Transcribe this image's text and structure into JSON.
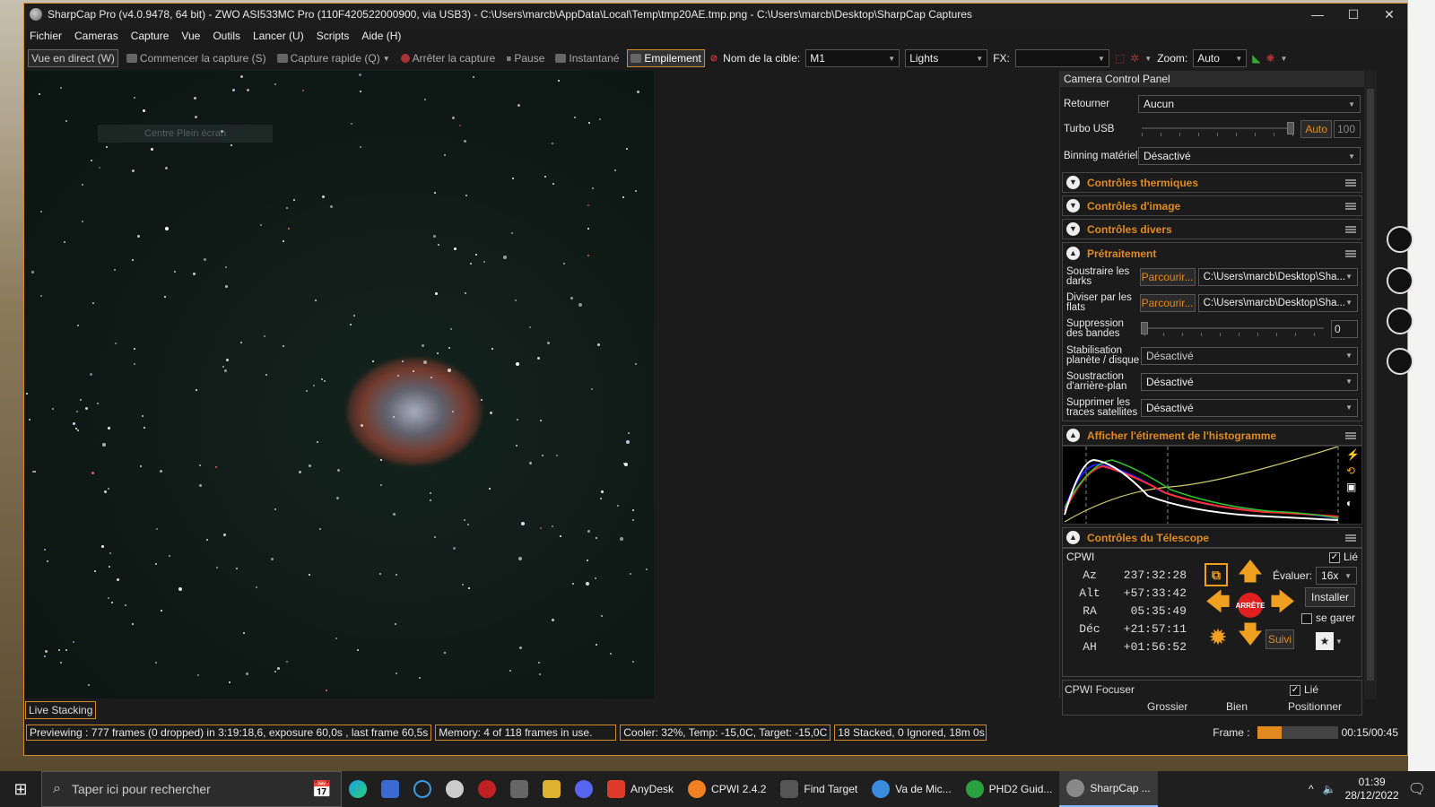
{
  "window": {
    "title": "SharpCap Pro (v4.0.9478, 64 bit) - ZWO ASI533MC Pro (110F420522000900, via USB3) - C:\\Users\\marcb\\AppData\\Local\\Temp\\tmp20AE.tmp.png - C:\\Users\\marcb\\Desktop\\SharpCap Captures",
    "minimize": "—",
    "maximize": "☐",
    "close": "✕"
  },
  "menu": [
    "Fichier",
    "Cameras",
    "Capture",
    "Vue",
    "Outils",
    "Lancer (U)",
    "Scripts",
    "Aide (H)"
  ],
  "toolbar": {
    "live_view": "Vue en direct (W)",
    "start_capture": "Commencer la capture (S)",
    "quick_capture": "Capture rapide (Q)",
    "stop_capture": "Arrêter la capture",
    "pause": "Pause",
    "snapshot": "Instantané",
    "stacking": "Empilement",
    "target_label": "Nom de la cible:",
    "target_value": "M1",
    "frame_type": "Lights",
    "fx_label": "FX:",
    "fx_value": "",
    "zoom_label": "Zoom:",
    "zoom_value": "Auto"
  },
  "viewer": {
    "faint_overlay": "Centre Plein écran"
  },
  "live_stacking_tab": "Live Stacking",
  "status": {
    "previewing": "Previewing : 777 frames (0 dropped) in 3:19:18,6, exposure 60,0s , last frame 60,5s",
    "memory": "Memory: 4 of 118 frames in use.",
    "cooler": "Cooler: 32%, Temp: -15,0C, Target: -15,0C",
    "stacked": "18 Stacked, 0 Ignored, 18m 0s",
    "frame_label": "Frame :",
    "frame_progress": 0.3,
    "time": "00:15/00:45"
  },
  "panel": {
    "title": "Camera Control Panel",
    "flip_label": "Retourner",
    "flip_value": "Aucun",
    "turbo_label": "Turbo USB",
    "turbo_auto": "Auto",
    "turbo_value": "100",
    "turbo_level": 0.98,
    "binning_label": "Binning matériel",
    "binning_value": "Désactivé",
    "sec_thermal": "Contrôles thermiques",
    "sec_image": "Contrôles d'image",
    "sec_misc": "Contrôles divers",
    "sec_preproc": "Prétraitement",
    "darks_label": "Soustraire les darks",
    "darks_btn": "Parcourir...",
    "darks_path": "C:\\Users\\marcb\\Desktop\\Sha...",
    "flats_label": "Diviser par les flats",
    "flats_btn": "Parcourir...",
    "flats_path": "C:\\Users\\marcb\\Desktop\\Sha...",
    "banding_label": "Suppression des bandes",
    "banding_value": "0",
    "banding_level": 0,
    "stab_label": "Stabilisation planète / disque",
    "stab_value": "Désactivé",
    "bg_label": "Soustraction d'arrière-plan",
    "bg_value": "Désactivé",
    "sat_label": "Supprimer les traces satellites",
    "sat_value": "Désactivé",
    "sec_hist": "Afficher l'étirement de l'histogramme",
    "sec_tel": "Contrôles du Télescope"
  },
  "telescope": {
    "name": "CPWI",
    "linked_label": "Lié",
    "az_label": "Az",
    "az": "237:32:28",
    "alt_label": "Alt",
    "alt": "+57:33:42",
    "ra_label": "RA",
    "ra": "05:35:49",
    "dec_label": "Déc",
    "dec": "+21:57:11",
    "ah_label": "AH",
    "ah": "+01:56:52",
    "stop_label": "ARRÊTE",
    "rate_label": "Évaluer:",
    "rate_value": "16x",
    "install_btn": "Installer",
    "park_label": "se garer",
    "track_btn": "Suivi"
  },
  "focuser": {
    "name": "CPWI Focuser",
    "linked_label": "Lié",
    "coarse": "Grossier",
    "fine": "Bien",
    "position": "Positionner"
  },
  "taskbar": {
    "search_placeholder": "Taper ici pour rechercher",
    "apps": [
      {
        "label": "AnyDesk",
        "color": "#e03a2a"
      },
      {
        "label": "CPWI 2.4.2",
        "color": "#f08020"
      },
      {
        "label": "Find Target",
        "color": "#555"
      },
      {
        "label": "Va de Mic...",
        "color": "#3a8ae0"
      },
      {
        "label": "PHD2 Guid...",
        "color": "#2aa040"
      },
      {
        "label": "SharpCap ...",
        "color": "#888"
      }
    ],
    "time": "01:39",
    "date": "28/12/2022"
  },
  "colors": {
    "accent": "#d08a2a",
    "section_text": "#e08a20",
    "window_bg": "#1b1b1b",
    "sky": "#0e1915"
  }
}
